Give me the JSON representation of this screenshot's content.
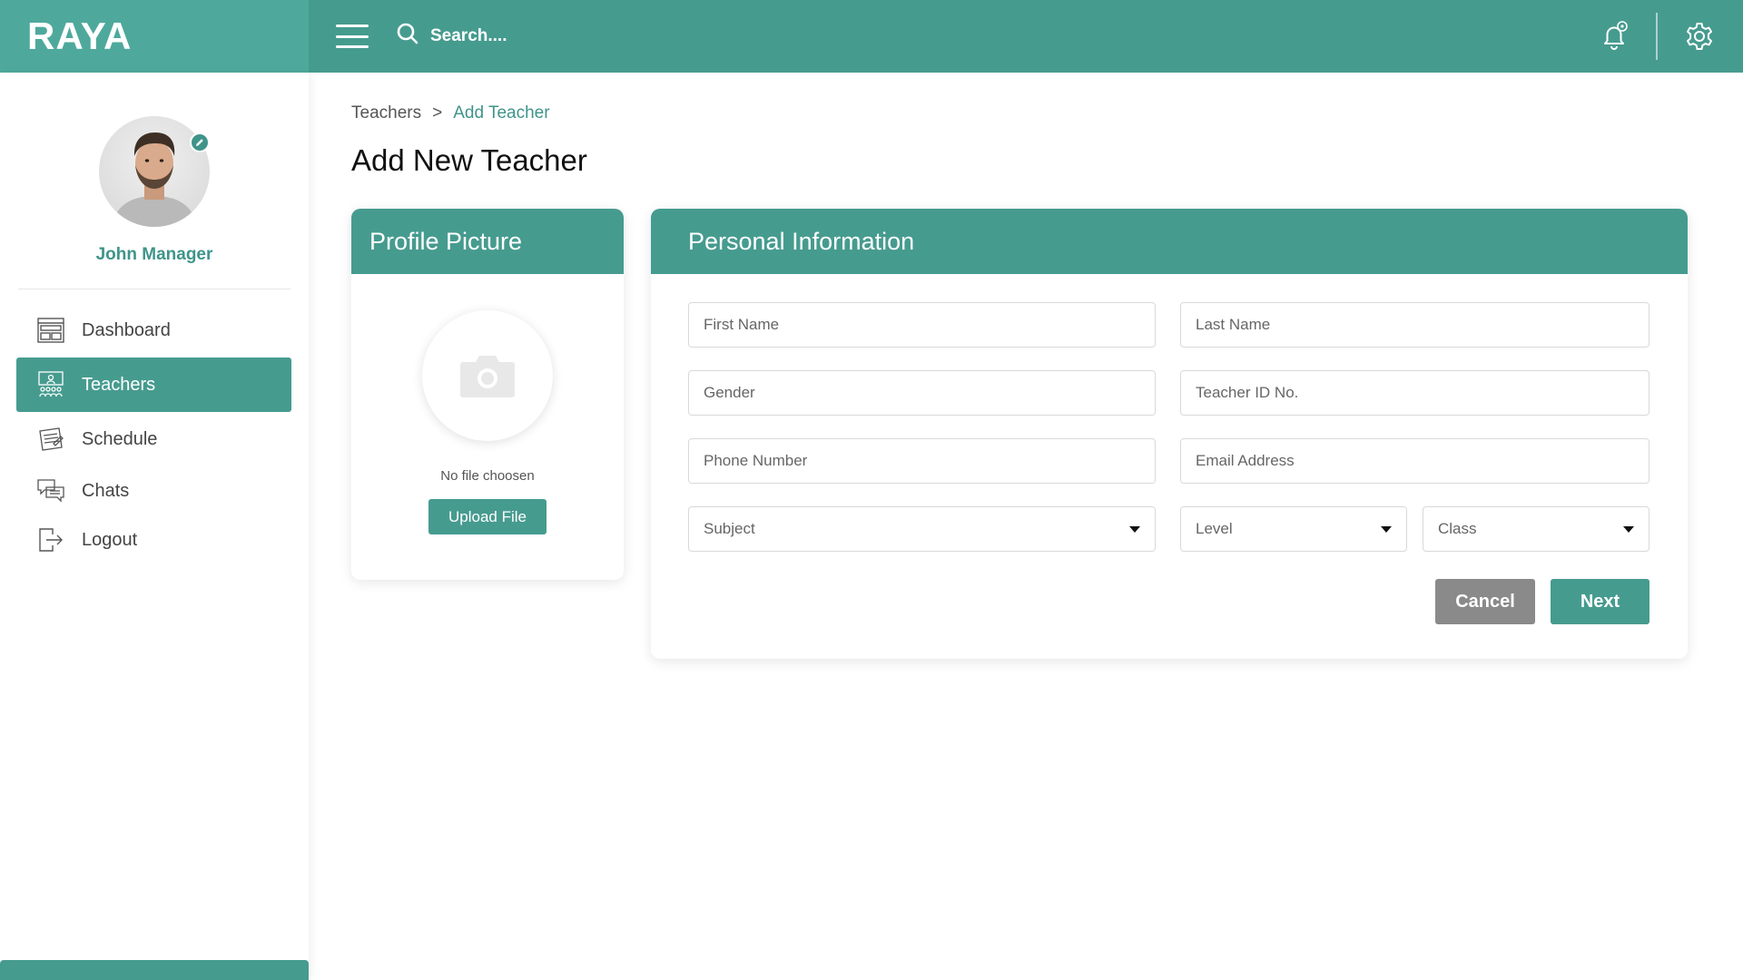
{
  "app": {
    "brand": "RAYA"
  },
  "topbar": {
    "search_placeholder": "Search....",
    "icons": [
      "menu-icon",
      "search-icon",
      "bell-icon",
      "gear-icon"
    ]
  },
  "sidebar": {
    "user_name": "John Manager",
    "items": [
      {
        "label": "Dashboard",
        "icon": "dashboard-icon",
        "active": false
      },
      {
        "label": "Teachers",
        "icon": "teachers-icon",
        "active": true
      },
      {
        "label": "Schedule",
        "icon": "schedule-icon",
        "active": false
      },
      {
        "label": "Chats",
        "icon": "chat-icon",
        "active": false
      },
      {
        "label": "Logout",
        "icon": "logout-icon",
        "active": false
      }
    ]
  },
  "breadcrumb": {
    "parent": "Teachers",
    "separator": ">",
    "current": "Add Teacher"
  },
  "page": {
    "title": "Add New Teacher"
  },
  "profile_card": {
    "title": "Profile Picture",
    "no_file_text": "No file choosen",
    "upload_label": "Upload File"
  },
  "personal_card": {
    "title": "Personal Information",
    "fields": {
      "first_name": "First Name",
      "last_name": "Last Name",
      "gender": "Gender",
      "teacher_id": "Teacher ID No.",
      "phone": "Phone Number",
      "email": "Email Address",
      "subject": "Subject",
      "level": "Level",
      "class": "Class"
    },
    "cancel_label": "Cancel",
    "next_label": "Next"
  },
  "colors": {
    "primary": "#469b8f",
    "brand_bg": "#4ea99c",
    "cancel": "#8a8a8a"
  }
}
